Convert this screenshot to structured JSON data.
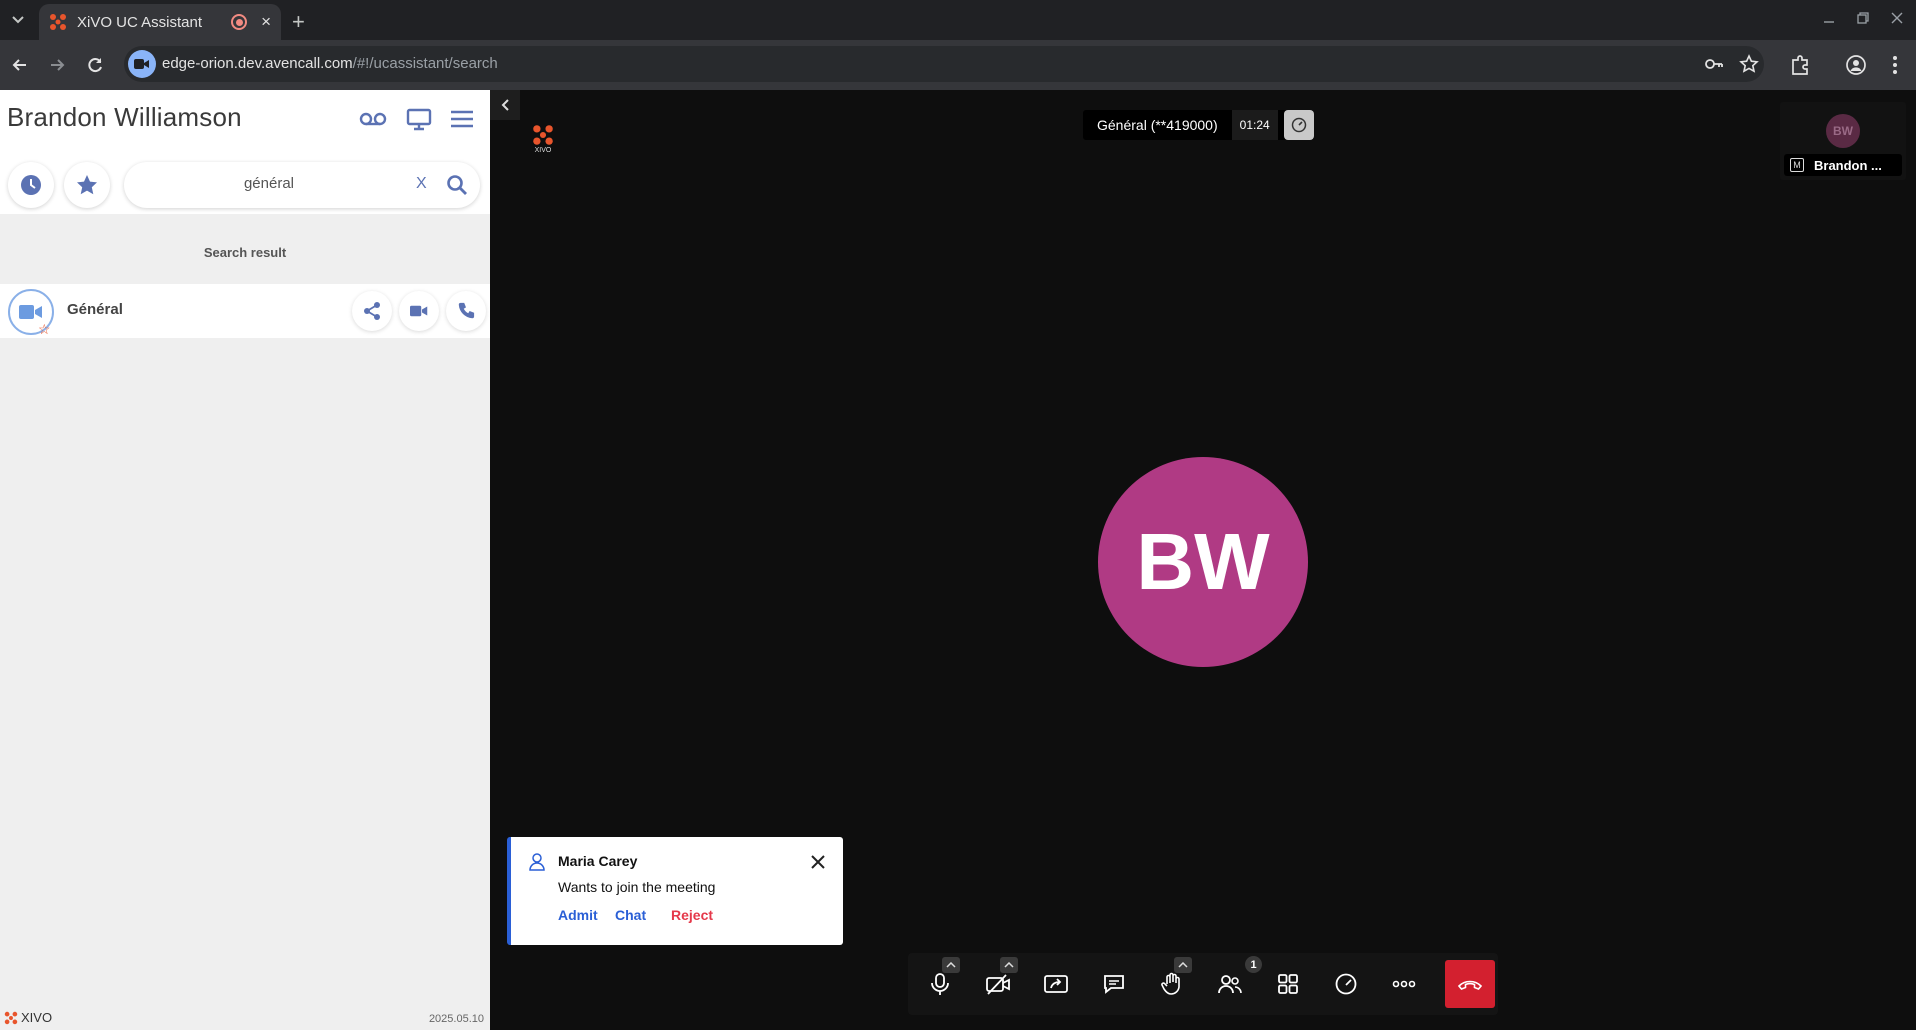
{
  "browser": {
    "tab_title": "XiVO UC Assistant",
    "tab_close": "×",
    "new_tab": "+",
    "url_host": "edge-orion.dev.avencall.com",
    "url_path": "/#!/ucassistant/search"
  },
  "left_panel": {
    "user_name": "Brandon Williamson",
    "search": {
      "value": "général",
      "clear_label": "X"
    },
    "result_header": "Search result",
    "results": [
      {
        "name": "Général"
      }
    ],
    "footer": {
      "logo_text": "XIVO",
      "version": "2025.05.10"
    }
  },
  "meeting": {
    "logo_text": "XIVO",
    "room_name": "Général (**419000)",
    "timer": "01:24",
    "main_avatar_initials": "BW",
    "thumbnail": {
      "initials": "BW",
      "badge": "M",
      "name": "Brandon ..."
    },
    "notification": {
      "name": "Maria Carey",
      "message": "Wants to join the meeting",
      "actions": {
        "admit": "Admit",
        "chat": "Chat",
        "reject": "Reject"
      }
    },
    "participants_count": "1",
    "colors": {
      "avatar": "#b03a84",
      "hangup": "#d3202f",
      "accent": "#2a5fd6",
      "reject": "#e5384a"
    }
  }
}
